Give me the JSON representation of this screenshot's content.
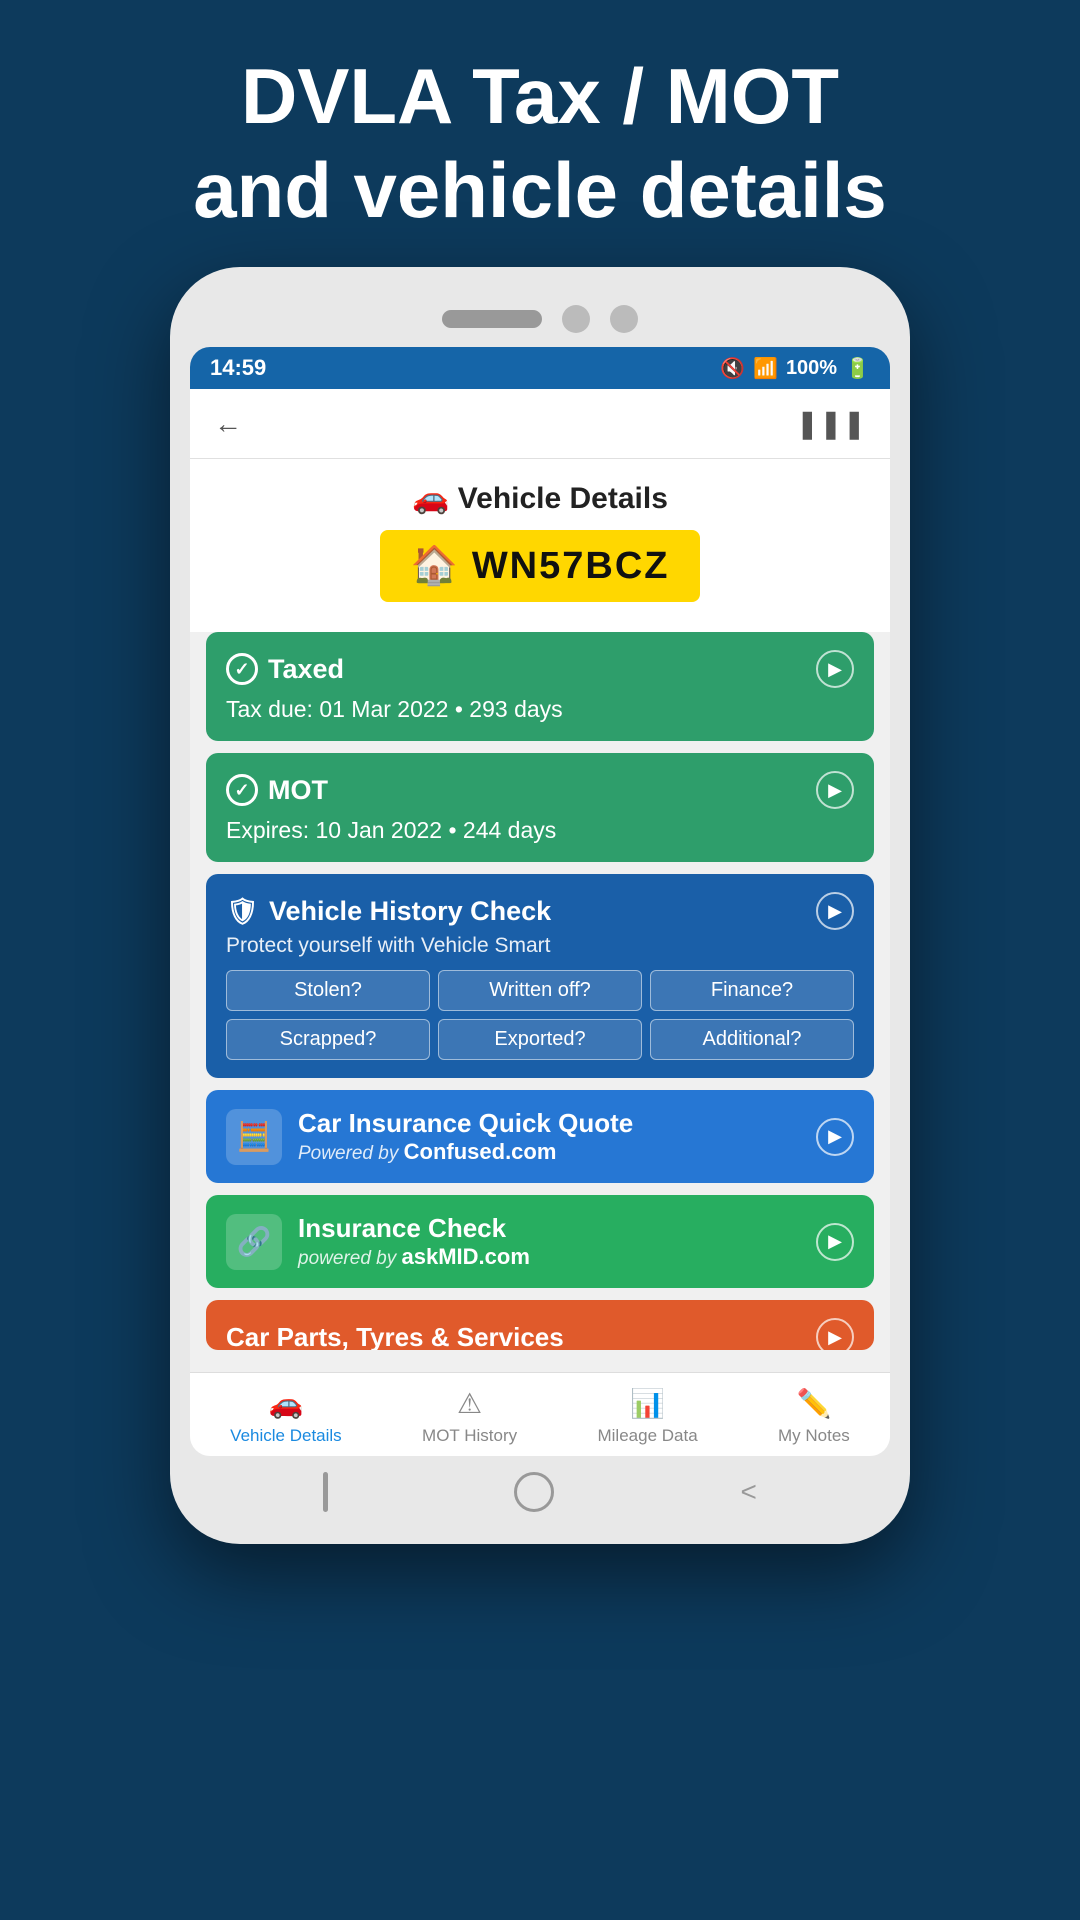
{
  "header": {
    "line1": "DVLA Tax / MOT",
    "line2": "and vehicle details"
  },
  "statusBar": {
    "time": "14:59",
    "battery": "100%"
  },
  "appHeader": {
    "backLabel": "←",
    "shareLabel": "⋮"
  },
  "vehicleTitle": "Vehicle Details",
  "numberPlate": "WN57BCZ",
  "taxCard": {
    "icon": "✓",
    "title": "Taxed",
    "subtitle": "Tax due: 01 Mar 2022 • 293 days"
  },
  "motCard": {
    "icon": "✓",
    "title": "MOT",
    "subtitle": "Expires: 10 Jan 2022 • 244 days"
  },
  "historyCard": {
    "title": "Vehicle History Check",
    "description": "Protect yourself with Vehicle Smart",
    "tags": [
      "Stolen?",
      "Written off?",
      "Finance?",
      "Scrapped?",
      "Exported?",
      "Additional?"
    ]
  },
  "insuranceQuoteCard": {
    "title": "Car Insurance Quick Quote",
    "poweredBy": "Powered by",
    "brand": "Confused.com"
  },
  "insuranceCheckCard": {
    "title": "Insurance Check",
    "poweredBy": "powered by",
    "brand": "askMID.com"
  },
  "carPartsCard": {
    "title": "Car Parts, Tyres & Services"
  },
  "bottomNav": {
    "items": [
      {
        "label": "Vehicle Details",
        "active": true
      },
      {
        "label": "MOT History",
        "active": false
      },
      {
        "label": "Mileage Data",
        "active": false
      },
      {
        "label": "My Notes",
        "active": false
      }
    ]
  }
}
